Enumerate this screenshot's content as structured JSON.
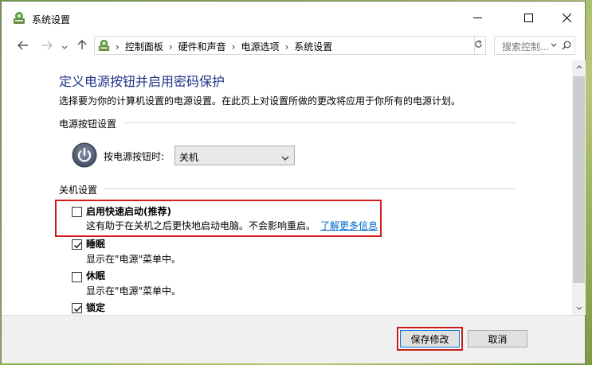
{
  "window": {
    "title": "系统设置"
  },
  "nav": {
    "breadcrumbs": [
      "控制面板",
      "硬件和声音",
      "电源选项",
      "系统设置"
    ],
    "search_placeholder": "搜索控制..."
  },
  "main": {
    "heading": "定义电源按钮并启用密码保护",
    "description": "选择要为你的计算机设置的电源设置。在此页上对设置所做的更改将应用于你所有的电源计划。",
    "power_section": {
      "label": "电源按钮设置",
      "power_button_label": "按电源按钮时:",
      "power_button_value": "关机"
    },
    "shutdown_section": {
      "label": "关机设置",
      "options": [
        {
          "label": "启用快速启动(推荐)",
          "desc": "这有助于在关机之后更快地启动电脑。不会影响重启。",
          "link": "了解更多信息",
          "checked": false
        },
        {
          "label": "睡眠",
          "desc": "显示在\"电源\"菜单中。",
          "checked": true
        },
        {
          "label": "休眠",
          "desc": "显示在\"电源\"菜单中。",
          "checked": false
        },
        {
          "label": "锁定",
          "checked": true
        }
      ]
    }
  },
  "footer": {
    "save_label": "保存修改",
    "cancel_label": "取消"
  },
  "colors": {
    "heading": "#1e3287",
    "link": "#0066cc",
    "highlight": "#d11c1c"
  }
}
